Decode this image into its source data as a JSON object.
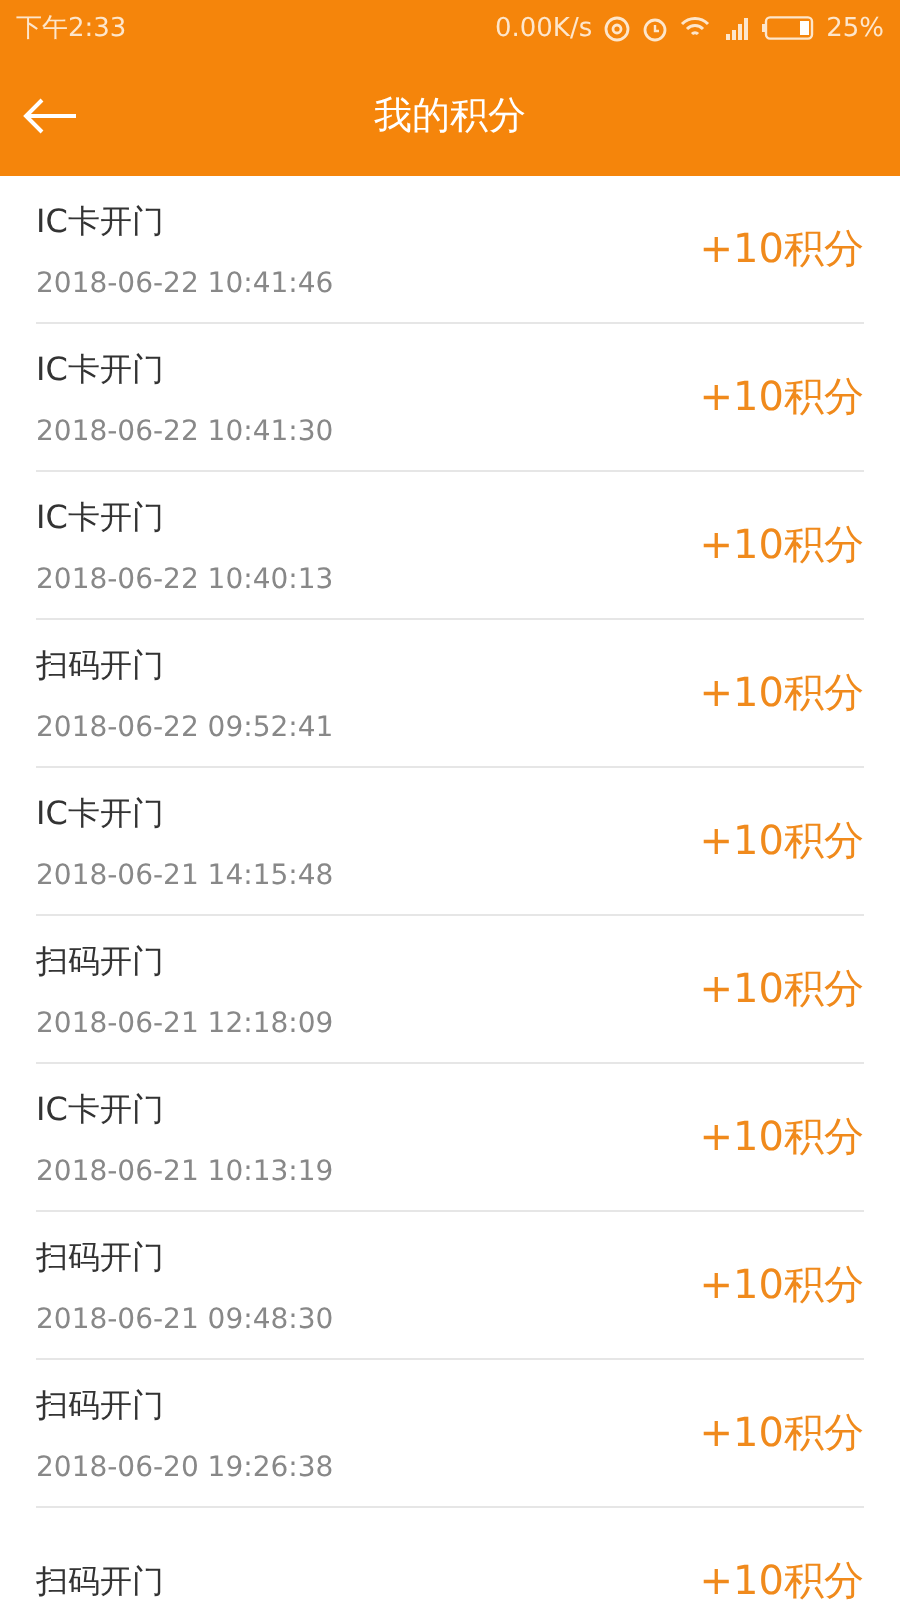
{
  "status_bar": {
    "time": "下午2:33",
    "speed": "0.00K/s",
    "battery": "25%"
  },
  "header": {
    "title": "我的积分"
  },
  "records": [
    {
      "title": "IC卡开门",
      "time": "2018-06-22 10:41:46",
      "points": "+10积分"
    },
    {
      "title": "IC卡开门",
      "time": "2018-06-22 10:41:30",
      "points": "+10积分"
    },
    {
      "title": "IC卡开门",
      "time": "2018-06-22 10:40:13",
      "points": "+10积分"
    },
    {
      "title": "扫码开门",
      "time": "2018-06-22 09:52:41",
      "points": "+10积分"
    },
    {
      "title": "IC卡开门",
      "time": "2018-06-21 14:15:48",
      "points": "+10积分"
    },
    {
      "title": "扫码开门",
      "time": "2018-06-21 12:18:09",
      "points": "+10积分"
    },
    {
      "title": "IC卡开门",
      "time": "2018-06-21 10:13:19",
      "points": "+10积分"
    },
    {
      "title": "扫码开门",
      "time": "2018-06-21 09:48:30",
      "points": "+10积分"
    },
    {
      "title": "扫码开门",
      "time": "2018-06-20 19:26:38",
      "points": "+10积分"
    },
    {
      "title": "扫码开门",
      "points": "+10积分"
    }
  ]
}
